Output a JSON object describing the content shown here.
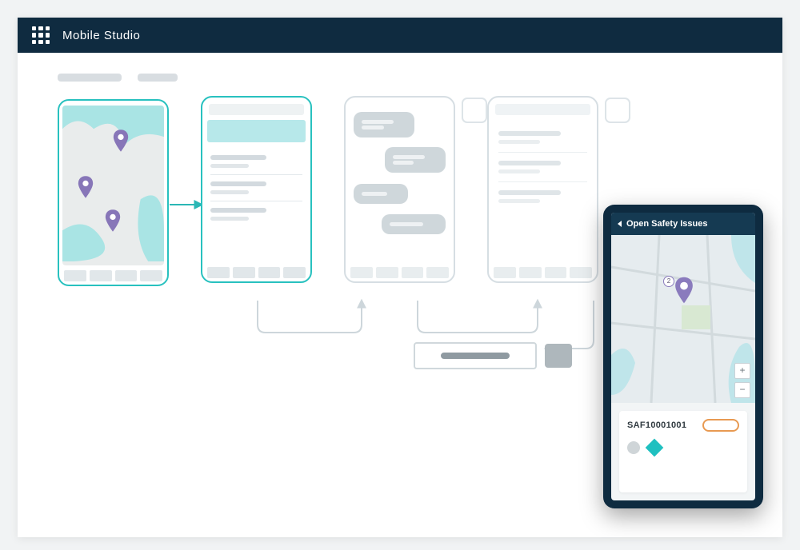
{
  "header": {
    "app_title": "Mobile Studio"
  },
  "device_overlay": {
    "header_label": "Open Safety Issues",
    "record_id": "SAF10001001",
    "pin_count": "2",
    "zoom_in": "+",
    "zoom_out": "−"
  },
  "colors": {
    "brand_dark": "#0f2b40",
    "accent_teal": "#28c1bf",
    "pin_purple": "#8776b8",
    "status_orange": "#e89a52"
  }
}
